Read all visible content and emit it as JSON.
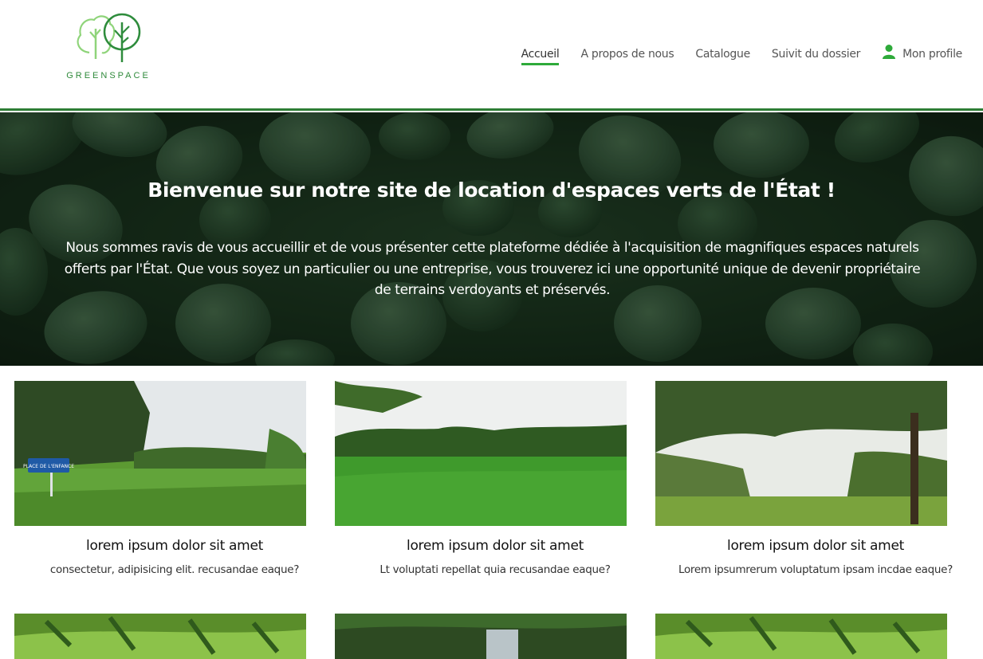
{
  "brand": {
    "name": "GREENSPACE",
    "color": "#2f8a3b",
    "accent": "#2eaa3a",
    "icon": "two-trees-logo"
  },
  "nav": {
    "items": [
      {
        "label": "Accueil",
        "active": true
      },
      {
        "label": "A propos de nous",
        "active": false
      },
      {
        "label": "Catalogue",
        "active": false
      },
      {
        "label": "Suivit du dossier",
        "active": false
      }
    ],
    "profile": {
      "label": "Mon profile",
      "icon": "user-icon"
    }
  },
  "hero": {
    "title": "Bienvenue sur notre site de location d'espaces verts de l'État !",
    "text": "Nous sommes ravis de vous accueillir et de vous présenter cette plateforme dédiée à l'acquisition de magnifiques espaces naturels offerts par l'État. Que vous soyez un particulier ou une entreprise, vous trouverez ici une opportunité unique de devenir propriétaire de terrains verdoyants et préservés."
  },
  "cards": [
    {
      "title": "lorem ipsum dolor sit amet",
      "description": "consectetur, adipisicing elit. recusandae eaque?",
      "sign_text": "PLACE DE L'ENFANCE"
    },
    {
      "title": "lorem ipsum dolor sit amet",
      "description": "Lt voluptati repellat quia recusandae eaque?"
    },
    {
      "title": "lorem ipsum dolor sit amet",
      "description": "Lorem ipsumrerum voluptatum ipsam incdae eaque?"
    }
  ]
}
